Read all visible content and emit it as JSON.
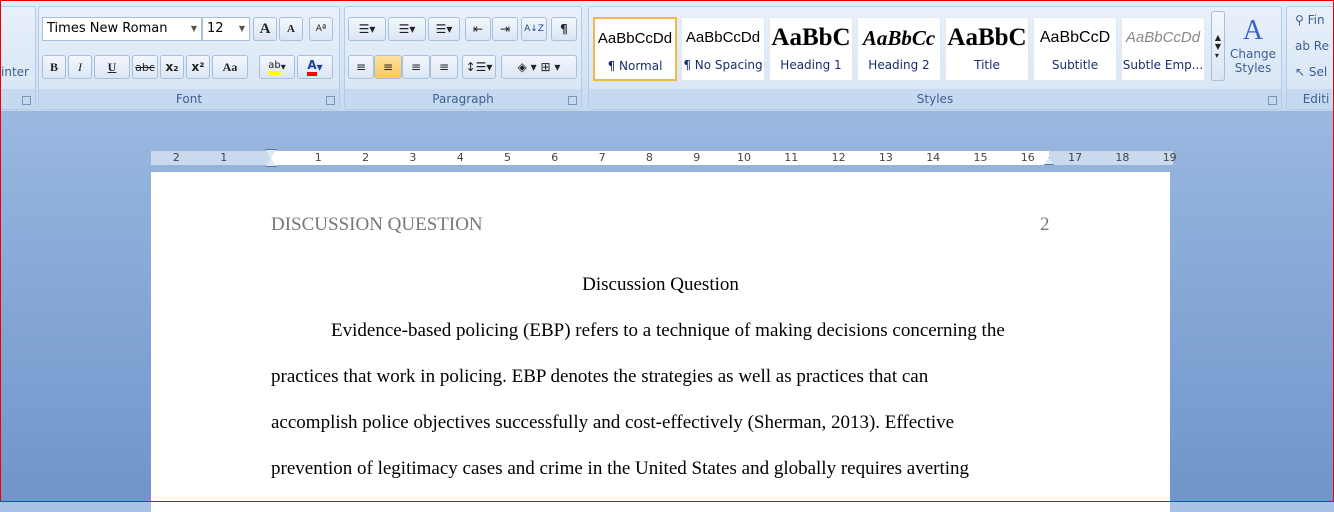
{
  "clipboard": {
    "partial_label": "inter"
  },
  "font": {
    "group_label": "Font",
    "font_name": "Times New Roman",
    "font_size": "12",
    "buttons": [
      "B",
      "I",
      "U",
      "abc",
      "x₂",
      "x²",
      "Aa"
    ],
    "grow": "A",
    "shrink": "A",
    "highlight_color": "#ffff00",
    "font_color": "#ff0000"
  },
  "paragraph": {
    "group_label": "Paragraph",
    "pilcrow": "¶",
    "sort": "A↓Z"
  },
  "styles": {
    "group_label": "Styles",
    "items": [
      {
        "preview": "AaBbCcDd",
        "name": "¶ Normal",
        "selected": true
      },
      {
        "preview": "AaBbCcDd",
        "name": "¶ No Spacing"
      },
      {
        "preview": "AaBbC",
        "name": "Heading 1"
      },
      {
        "preview": "AaBbCc",
        "name": "Heading 2"
      },
      {
        "preview": "AaBbC",
        "name": "Title"
      },
      {
        "preview": "AaBbCcD",
        "name": "Subtitle"
      },
      {
        "preview": "AaBbCcDd",
        "name": "Subtle Emp..."
      }
    ],
    "change_styles": "Change Styles"
  },
  "editing": {
    "group_label": "Editi",
    "find": "Fin",
    "replace": "Re",
    "select": "Sel"
  },
  "ruler": {
    "left": [
      "2",
      "1"
    ],
    "right": [
      "1",
      "2",
      "3",
      "4",
      "5",
      "6",
      "7",
      "8",
      "9",
      "10",
      "11",
      "12",
      "13",
      "14",
      "15",
      "16",
      "17",
      "18",
      "19"
    ]
  },
  "document": {
    "header": "DISCUSSION QUESTION",
    "page_number": "2",
    "title": "Discussion Question",
    "lines": [
      "Evidence-based policing (EBP) refers to a technique of making decisions concerning the",
      "practices that work in policing. EBP denotes the strategies as well as practices that can",
      "accomplish police objectives successfully and cost-effectively (Sherman, 2013). Effective",
      "prevention of legitimacy cases and crime in the United States and globally requires averting"
    ]
  }
}
